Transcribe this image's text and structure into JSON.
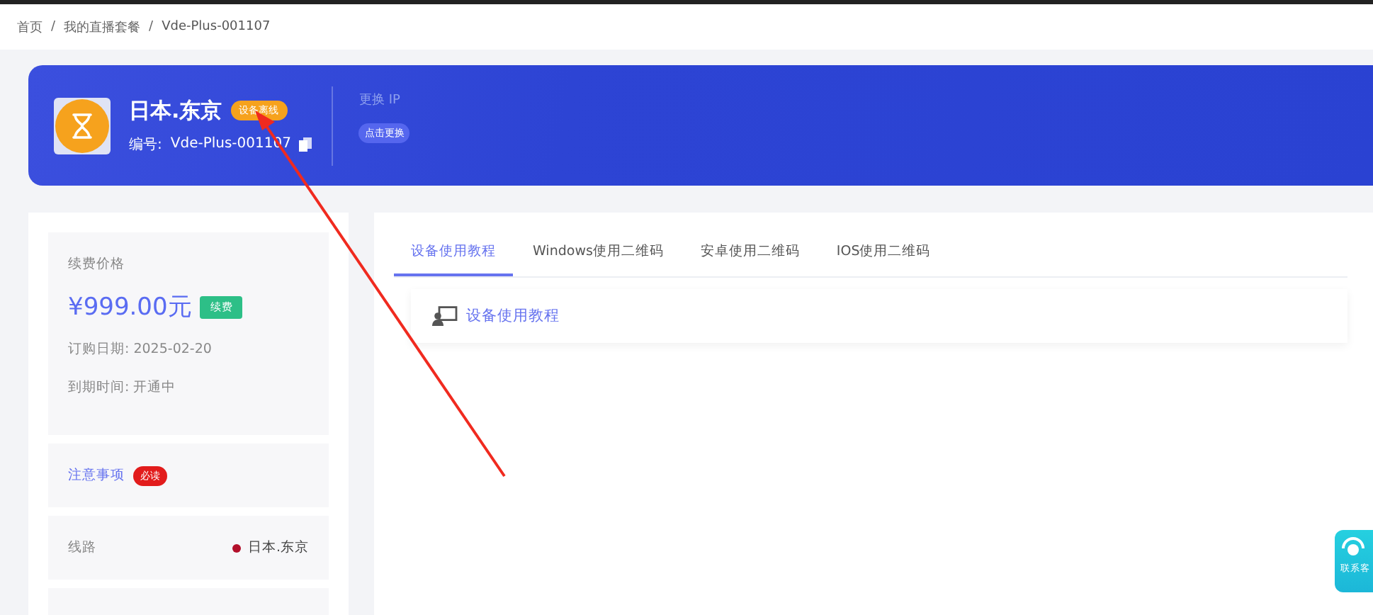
{
  "breadcrumb": [
    "首页",
    "我的直播套餐",
    "Vde-Plus-001107"
  ],
  "breadcrumb_separator": "/",
  "device": {
    "name": "日本.东京",
    "status": "设备离线",
    "id_label": "编号:",
    "id": "Vde-Plus-001107"
  },
  "ip": {
    "label": "更换 IP",
    "button": "点击更换"
  },
  "price": {
    "label": "续费价格",
    "amount": "¥999.00元",
    "renew": "续费",
    "order_date": "订购日期: 2025-02-20",
    "expiry": "到期时间: 开通中"
  },
  "notice": {
    "link": "注意事项",
    "badge": "必读"
  },
  "route": {
    "label": "线路",
    "value": "日本.东京"
  },
  "tabs": [
    {
      "label": "设备使用教程",
      "selected": true
    },
    {
      "label": "Windows使用二维码",
      "selected": false
    },
    {
      "label": "安卓使用二维码",
      "selected": false
    },
    {
      "label": "IOS使用二维码",
      "selected": false
    }
  ],
  "tutorial": {
    "title": "设备使用教程"
  },
  "support": {
    "label": "联系客"
  }
}
